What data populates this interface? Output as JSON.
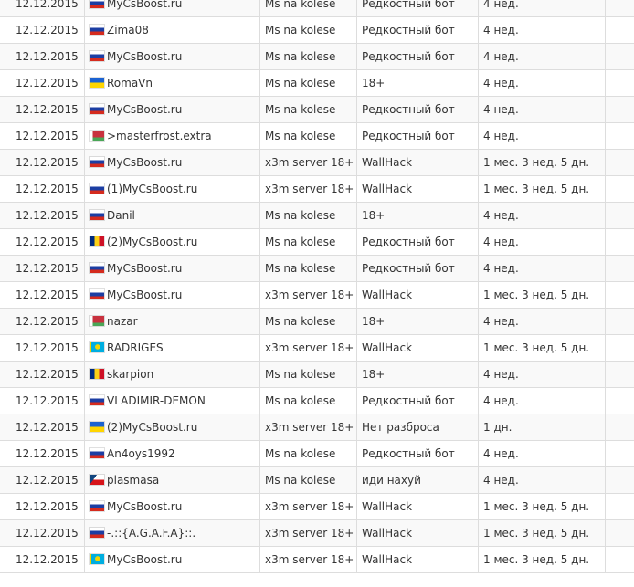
{
  "bans": {
    "rows": [
      {
        "date": "12.12.2015",
        "flag": "ru-flag-icon",
        "name": "MyCsBoost.ru",
        "server": "Ms na kolese",
        "reason": "Редкостный бот",
        "term": "4 нед."
      },
      {
        "date": "12.12.2015",
        "flag": "ru-flag-icon",
        "name": "Zima08",
        "server": "Ms na kolese",
        "reason": "Редкостный бот",
        "term": "4 нед."
      },
      {
        "date": "12.12.2015",
        "flag": "ru-flag-icon",
        "name": "MyCsBoost.ru",
        "server": "Ms na kolese",
        "reason": "Редкостный бот",
        "term": "4 нед."
      },
      {
        "date": "12.12.2015",
        "flag": "ua-flag-icon",
        "name": "RomaVn",
        "server": "Ms na kolese",
        "reason": "18+",
        "term": "4 нед."
      },
      {
        "date": "12.12.2015",
        "flag": "ru-flag-icon",
        "name": "MyCsBoost.ru",
        "server": "Ms na kolese",
        "reason": "Редкостный бот",
        "term": "4 нед."
      },
      {
        "date": "12.12.2015",
        "flag": "by-flag-icon",
        "name": ">masterfrost.extra",
        "server": "Ms na kolese",
        "reason": "Редкостный бот",
        "term": "4 нед."
      },
      {
        "date": "12.12.2015",
        "flag": "ru-flag-icon",
        "name": "MyCsBoost.ru",
        "server": "x3m server 18+",
        "reason": "WallHack",
        "term": "1 мес. 3 нед. 5 дн."
      },
      {
        "date": "12.12.2015",
        "flag": "ru-flag-icon",
        "name": "(1)MyCsBoost.ru",
        "server": "x3m server 18+",
        "reason": "WallHack",
        "term": "1 мес. 3 нед. 5 дн."
      },
      {
        "date": "12.12.2015",
        "flag": "ru-flag-icon",
        "name": "Danil",
        "server": "Ms na kolese",
        "reason": "18+",
        "term": "4 нед."
      },
      {
        "date": "12.12.2015",
        "flag": "ro-flag-icon",
        "name": "(2)MyCsBoost.ru",
        "server": "Ms na kolese",
        "reason": "Редкостный бот",
        "term": "4 нед."
      },
      {
        "date": "12.12.2015",
        "flag": "ru-flag-icon",
        "name": "MyCsBoost.ru",
        "server": "Ms na kolese",
        "reason": "Редкостный бот",
        "term": "4 нед."
      },
      {
        "date": "12.12.2015",
        "flag": "ru-flag-icon",
        "name": "MyCsBoost.ru",
        "server": "x3m server 18+",
        "reason": "WallHack",
        "term": "1 мес. 3 нед. 5 дн."
      },
      {
        "date": "12.12.2015",
        "flag": "by-flag-icon",
        "name": "nazar",
        "server": "Ms na kolese",
        "reason": "18+",
        "term": "4 нед."
      },
      {
        "date": "12.12.2015",
        "flag": "kz-flag-icon",
        "name": "RADRIGES",
        "server": "x3m server 18+",
        "reason": "WallHack",
        "term": "1 мес. 3 нед. 5 дн."
      },
      {
        "date": "12.12.2015",
        "flag": "ro-flag-icon",
        "name": "skarpion",
        "server": "Ms na kolese",
        "reason": "18+",
        "term": "4 нед."
      },
      {
        "date": "12.12.2015",
        "flag": "ru-flag-icon",
        "name": "VLADIMIR-DEMON",
        "server": "Ms na kolese",
        "reason": "Редкостный бот",
        "term": "4 нед."
      },
      {
        "date": "12.12.2015",
        "flag": "ua-flag-icon",
        "name": "(2)MyCsBoost.ru",
        "server": "x3m server 18+",
        "reason": "Нет разброса",
        "term": "1 дн."
      },
      {
        "date": "12.12.2015",
        "flag": "ru-flag-icon",
        "name": "An4oys1992",
        "server": "Ms na kolese",
        "reason": "Редкостный бот",
        "term": "4 нед."
      },
      {
        "date": "12.12.2015",
        "flag": "cz-flag-icon",
        "name": "plasmasa",
        "server": "Ms na kolese",
        "reason": "иди нахуй",
        "term": "4 нед."
      },
      {
        "date": "12.12.2015",
        "flag": "ru-flag-icon",
        "name": "MyCsBoost.ru",
        "server": "x3m server 18+",
        "reason": "WallHack",
        "term": "1 мес. 3 нед. 5 дн."
      },
      {
        "date": "12.12.2015",
        "flag": "ru-flag-icon",
        "name": "-.::{A.G.A.F.A}::.",
        "server": "x3m server 18+",
        "reason": "WallHack",
        "term": "1 мес. 3 нед. 5 дн."
      },
      {
        "date": "12.12.2015",
        "flag": "kz-flag-icon",
        "name": "MyCsBoost.ru",
        "server": "x3m server 18+",
        "reason": "WallHack",
        "term": "1 мес. 3 нед. 5 дн."
      }
    ]
  },
  "colors": {
    "text": "#333333",
    "border": "#dddddd",
    "row_alt_background": "#f9f9f9"
  }
}
